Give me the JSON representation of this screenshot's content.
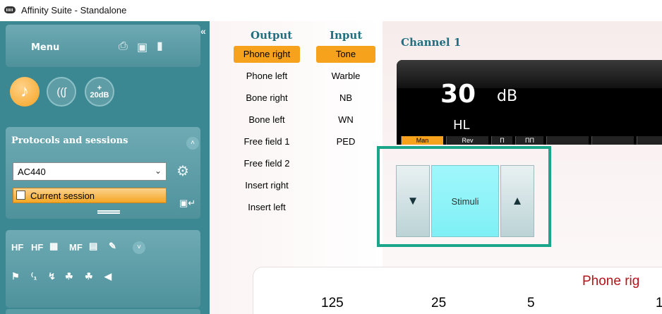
{
  "window": {
    "title": "Affinity Suite - Standalone",
    "collapse_glyph": "«"
  },
  "menu": {
    "label": "Menu",
    "icons": [
      "print-icon",
      "save-icon",
      "exit-icon"
    ]
  },
  "test_buttons": {
    "tone_icon": "♪",
    "speech_icon": "((ʃ",
    "plus_label": "+",
    "db_label": "20dB"
  },
  "protocols": {
    "title": "Protocols and sessions",
    "protocol_value": "AC440",
    "session_label": "Current session"
  },
  "tools": {
    "row1": [
      "HF",
      "HF",
      "MF"
    ],
    "row1_icons": [
      "hf-z-icon",
      "audiogram-icon",
      "lock-icon",
      "edit-icon"
    ],
    "row2_icons": [
      "flag-icon",
      "numbers-icon",
      "graph-icon",
      "mask-icon",
      "masking-a-icon",
      "speaker-icon"
    ]
  },
  "output": {
    "header": "Output",
    "items": [
      "Phone right",
      "Phone left",
      "Bone right",
      "Bone left",
      "Free field 1",
      "Free field 2",
      "Insert right",
      "Insert left"
    ],
    "selected": 0
  },
  "input": {
    "header": "Input",
    "items": [
      "Tone",
      "Warble",
      "NB",
      "WN",
      "PED"
    ],
    "selected": 0
  },
  "channel": {
    "title": "Channel 1",
    "value": "30",
    "unit": "dB",
    "scale": "HL",
    "mini_labels": [
      "Man",
      "Rev",
      "Π",
      "ΠΠ"
    ],
    "stimuli_label": "Stimuli"
  },
  "audiogram": {
    "title": "Phone rig",
    "frequencies": [
      "125",
      "25",
      "5",
      "1"
    ]
  },
  "colors": {
    "accent": "#f7a21c",
    "teal": "#3b8893",
    "highlight": "#1ba58b",
    "stimuli": "#8ff2f8"
  }
}
